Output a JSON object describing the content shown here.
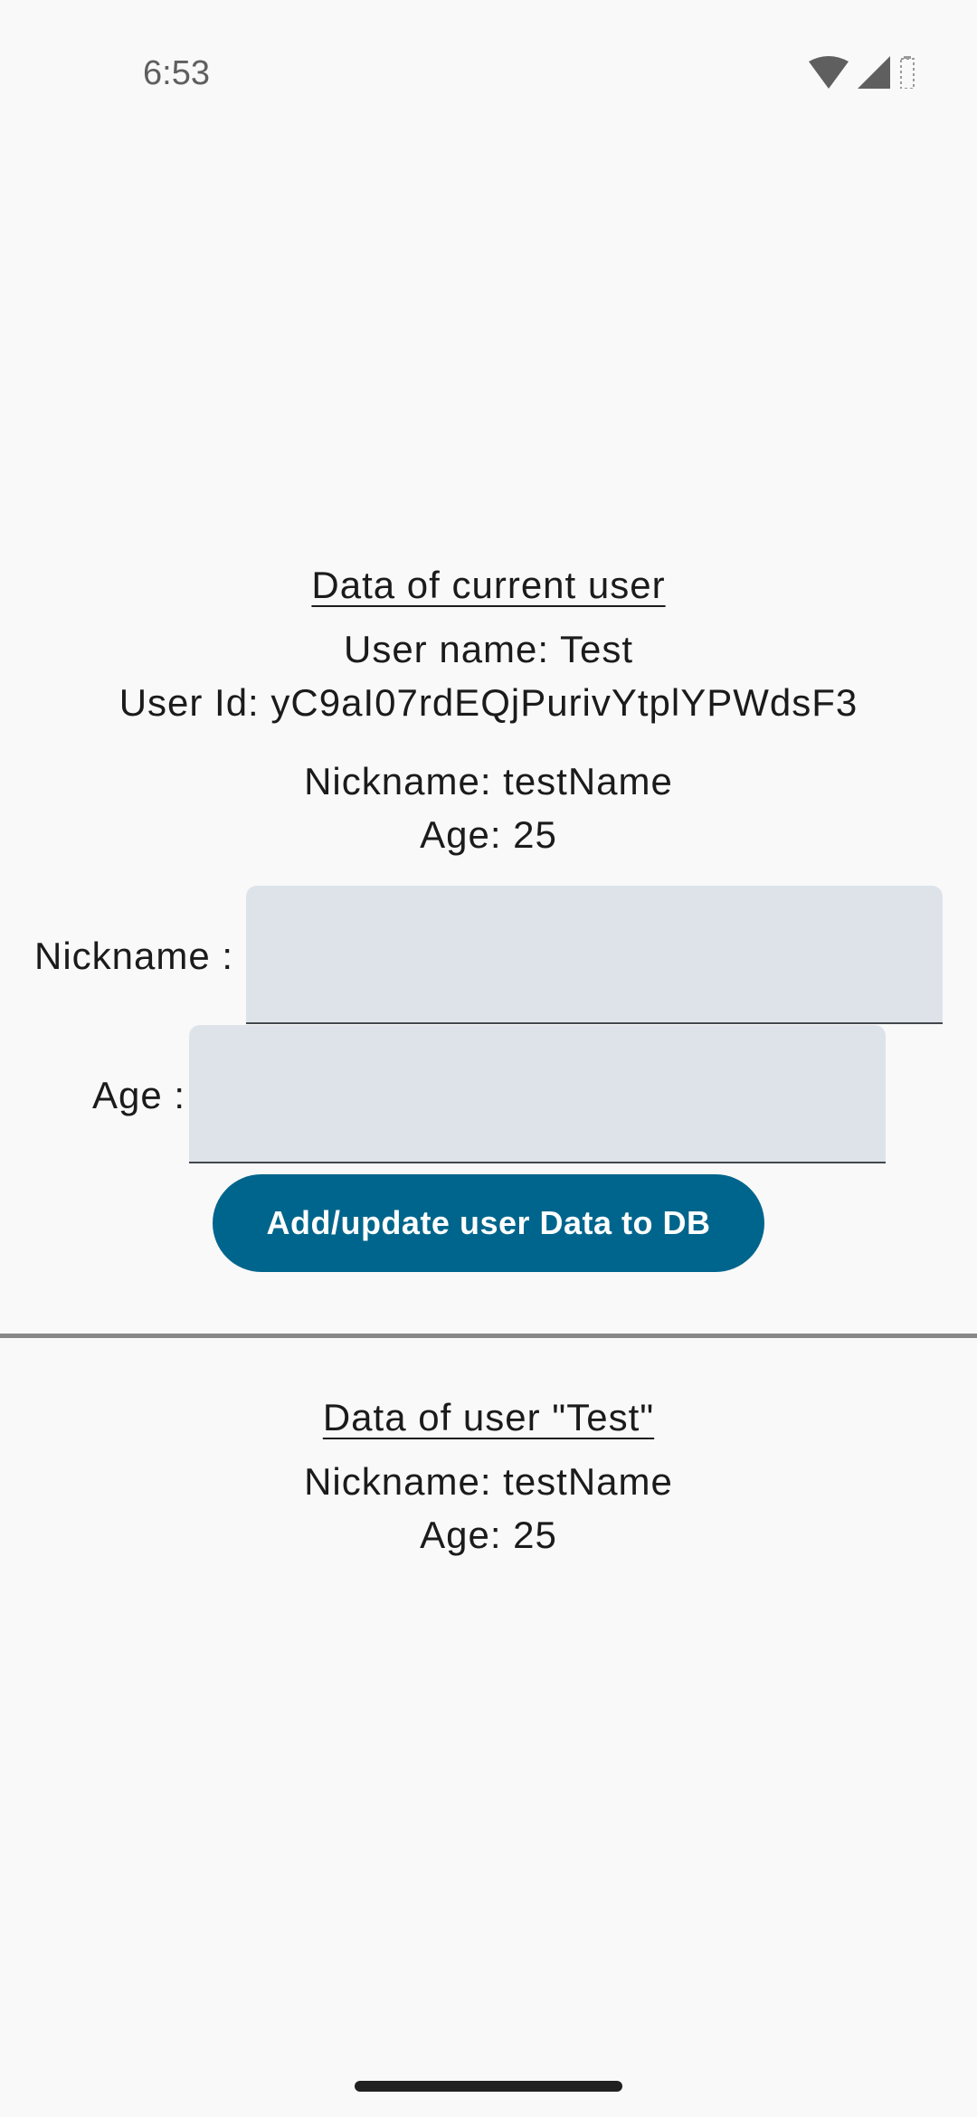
{
  "status_bar": {
    "time": "6:53",
    "icons": [
      "wifi-icon",
      "cell-signal-icon",
      "battery-icon"
    ]
  },
  "current_user": {
    "heading": "Data of current user",
    "user_name": "User name: Test",
    "user_id": "User Id: yC9aI07rdEQjPurivYtplYPWdsF3",
    "nickname": "Nickname: testName",
    "age": "Age: 25"
  },
  "form": {
    "nickname_label": "Nickname :",
    "nickname_value": "",
    "age_label": "Age :",
    "age_value": "",
    "submit_label": "Add/update user Data to DB"
  },
  "queried_user": {
    "heading": "Data of user \"Test\"",
    "nickname": "Nickname: testName",
    "age": "Age: 25"
  },
  "colors": {
    "background": "#f9f9f9",
    "field_fill": "#dee3ea",
    "button": "#00658c",
    "divider": "#888888"
  }
}
